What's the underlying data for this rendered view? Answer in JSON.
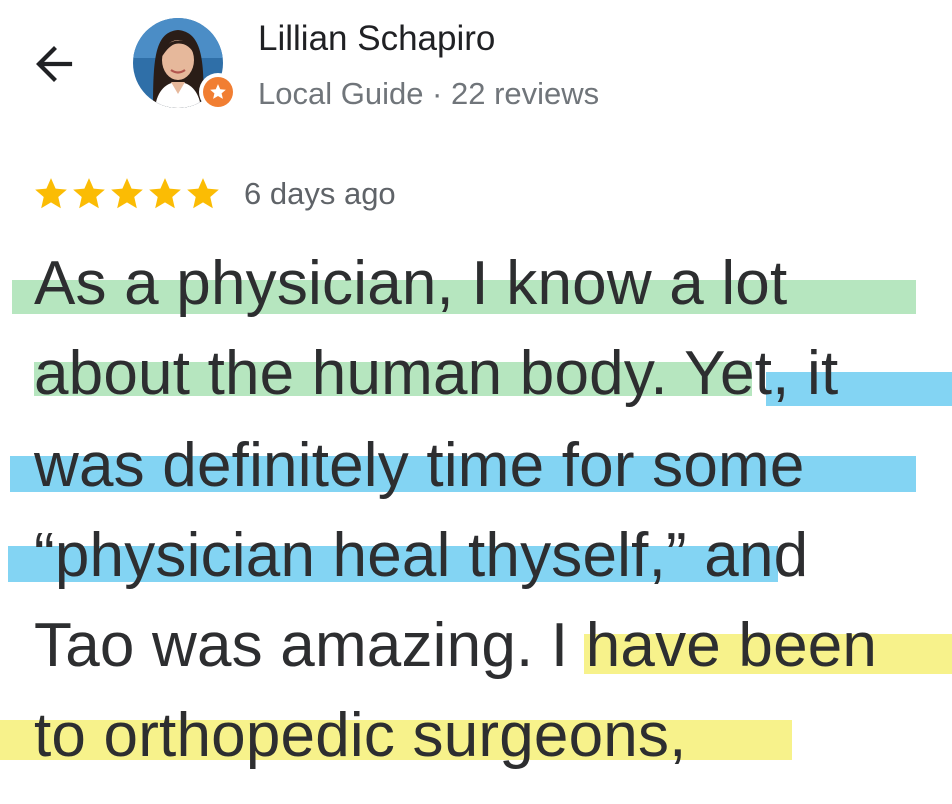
{
  "header": {
    "back_icon": "arrow-left-icon",
    "user_name": "Lillian Schapiro",
    "user_meta": "Local Guide · 22 reviews",
    "badge_icon": "local-guide-star-icon",
    "badge_color": "#f17e32"
  },
  "review": {
    "rating": 5,
    "rating_max": 5,
    "star_color": "#fbbc04",
    "date": "6 days ago",
    "lines": [
      "As a physician, I know a lot",
      "about the human body.  Yet, it",
      "was definitely time for some",
      "“physician heal thyself,” and",
      "Tao was amazing.  I have been",
      "to orthopedic surgeons,"
    ],
    "highlight_colors": {
      "green": "#a9e2b4",
      "blue": "#6dccf1",
      "yellow": "#f6f17e"
    }
  }
}
